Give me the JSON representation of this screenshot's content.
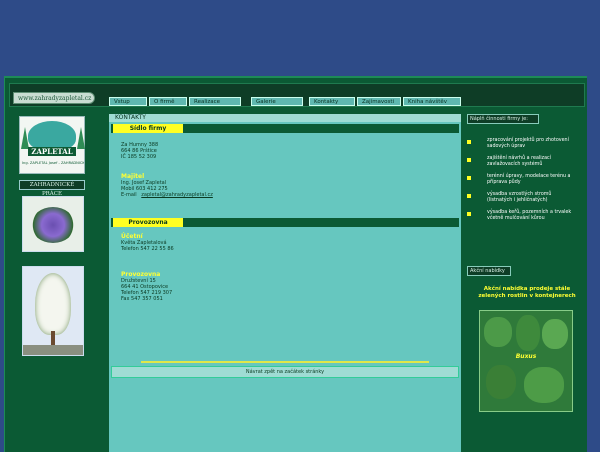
{
  "header": {
    "url": "www.zahradyzapletal.cz"
  },
  "nav": {
    "items": [
      "Vstup",
      "O firmě",
      "Realizace",
      "Galerie",
      "Kontakty",
      "Zajímavosti",
      "Kniha návštěv"
    ]
  },
  "left": {
    "logo_name": "ZAPLETAL",
    "logo_sub": "Ing. ZAPLETAL Josef - ZAHRADNICKÉ PRÁCE",
    "section_label": "ZAHRADNICKÉ PRÁCE"
  },
  "main": {
    "title": "KONTAKTY",
    "sidlo": {
      "heading": "Sídlo firmy",
      "address": [
        "Za Humny 388",
        "664 86 Prštice",
        "IČ 185 52 309"
      ],
      "majitel_label": "Majitel",
      "majitel": "Ing. Josef Zapletal",
      "mobil": "Mobil    603 412 275",
      "email_label": "E-mail",
      "email": "zapletal@zahradyzapletal.cz"
    },
    "provozovna": {
      "heading": "Provozovna",
      "ucetni_label": "Účetní",
      "ucetni_name": "Květa Zapletalová",
      "ucetni_tel": "Telefon   547 22 55 86",
      "prov_label": "Provozovna",
      "prov_lines": [
        "Družstevní 15",
        "664 41 Ostopovice",
        "Telefon 547 219 307",
        "Fax      547 357 051"
      ]
    },
    "back_link": "Návrat zpět na začátek stránky"
  },
  "right": {
    "heading": "Náplň činnosti firmy je:",
    "items": [
      "zpracování projektů pro zhotovení sadových úprav",
      "zajištění návrhů a realizací zavlažovacích systémů",
      "terénní úpravy, modelace terénu a příprava půdy",
      "výsadba vzrostlých stromů (listnatých i jehličnatých)",
      "výsadba keřů, pozemních a trvalek včetně mulčování kůrou"
    ],
    "offers_label": "Akční nabídky",
    "akce_text": "Akční nabídka prodeje stále zelených rostlin v kontejnerech",
    "buxus_label": "Buxus"
  },
  "colors": {
    "page_bg": "#2e4b88",
    "frame": "#0b5a34",
    "content": "#66c7bf",
    "accent": "#ffff22"
  }
}
